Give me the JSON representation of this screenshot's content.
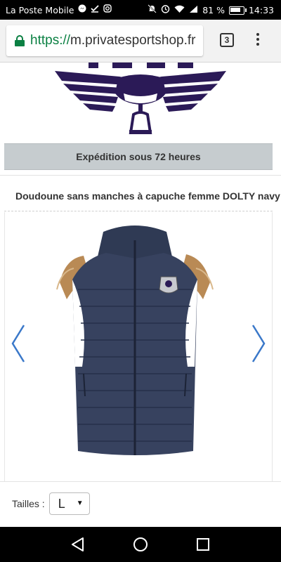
{
  "status_bar": {
    "carrier": "La Poste Mobile",
    "battery": "81 %",
    "time": "14:33",
    "battery_level": 0.81,
    "icons": [
      "messenger-icon",
      "check-icon",
      "instagram-icon",
      "mute-icon",
      "alarm-icon",
      "wifi-icon",
      "signal-icon",
      "battery-icon"
    ]
  },
  "browser": {
    "url_scheme": "https://",
    "url_host": "m.privatesportshop.fr",
    "tab_count": "3",
    "secure": true,
    "accent_color": "#0b8043"
  },
  "page": {
    "shipping_banner": "Expédition sous 72 heures",
    "product_title": "Doudoune sans manches à capuche femme DOLTY navy",
    "size_label": "Tailles :",
    "size_selected": "L",
    "logo_color": "#2b1a57",
    "arrow_color": "#3a78c9",
    "price_color": "#b3001b"
  },
  "nav_bar": {
    "buttons": [
      "back-icon",
      "home-icon",
      "recents-icon"
    ]
  }
}
